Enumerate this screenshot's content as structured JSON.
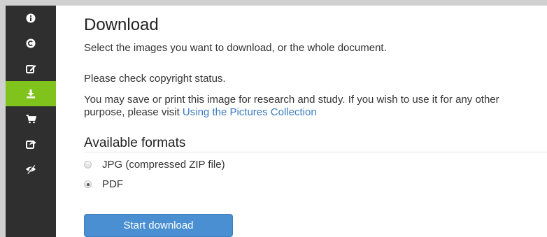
{
  "sidebar": {
    "items": [
      {
        "icon": "info-icon",
        "active": false
      },
      {
        "icon": "copyright-icon",
        "active": false
      },
      {
        "icon": "edit-icon",
        "active": false
      },
      {
        "icon": "download-icon",
        "active": true
      },
      {
        "icon": "cart-icon",
        "active": false
      },
      {
        "icon": "share-icon",
        "active": false
      },
      {
        "icon": "eye-slash-icon",
        "active": false
      }
    ],
    "background_color": "#2f2f2f",
    "active_color": "#7fc31c"
  },
  "main": {
    "title": "Download",
    "intro": "Select the images you want to download, or the whole document.",
    "copyright_notice": "Please check copyright status.",
    "usage_text": "You may save or print this image for research and study. If you wish to use it for any other purpose, please visit ",
    "usage_link": "Using the Pictures Collection",
    "formats_heading": "Available formats",
    "formats": [
      {
        "label": "JPG (compressed ZIP file)",
        "selected": false
      },
      {
        "label": "PDF",
        "selected": true
      }
    ],
    "start_button": "Start download",
    "link_color": "#3a7bbf",
    "button_color": "#4a8fd2"
  }
}
